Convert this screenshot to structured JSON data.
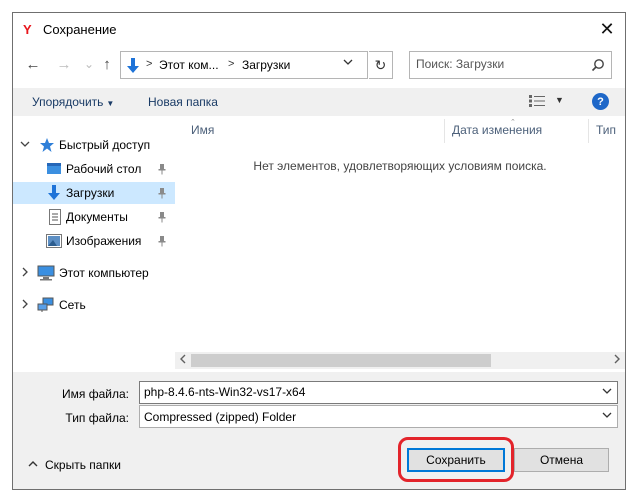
{
  "window": {
    "app_logo": "Y",
    "title": "Сохранение",
    "close_glyph": "✕"
  },
  "nav": {
    "back_glyph": "←",
    "forward_glyph": "→",
    "recent_glyph": "⌄",
    "up_glyph": "↑",
    "refresh_glyph": "↻"
  },
  "address": {
    "crumbs": [
      "Этот ком...",
      "Загрузки"
    ],
    "separator": ">"
  },
  "search": {
    "placeholder": "Поиск: Загрузки"
  },
  "toolbar": {
    "organize_label": "Упорядочить",
    "new_folder_label": "Новая папка",
    "help_label": "?"
  },
  "tree": {
    "quick_access": "Быстрый доступ",
    "desktop": "Рабочий стол",
    "downloads": "Загрузки",
    "documents": "Документы",
    "pictures": "Изображения",
    "this_pc": "Этот компьютер",
    "network": "Сеть"
  },
  "filelist": {
    "columns": [
      "Имя",
      "Дата изменения",
      "Тип"
    ],
    "empty_message": "Нет элементов, удовлетворяющих условиям поиска."
  },
  "form": {
    "filename_label": "Имя файла:",
    "filename_value": "php-8.4.6-nts-Win32-vs17-x64",
    "filetype_label": "Тип файла:",
    "filetype_value": "Compressed (zipped) Folder"
  },
  "footer": {
    "hide_folders_label": "Скрыть папки",
    "save_label": "Сохранить",
    "cancel_label": "Отмена"
  },
  "colors": {
    "accent": "#0078d7",
    "selection": "#cce8ff",
    "highlight_annotation": "#e3242b",
    "app_logo": "#e8161c"
  }
}
